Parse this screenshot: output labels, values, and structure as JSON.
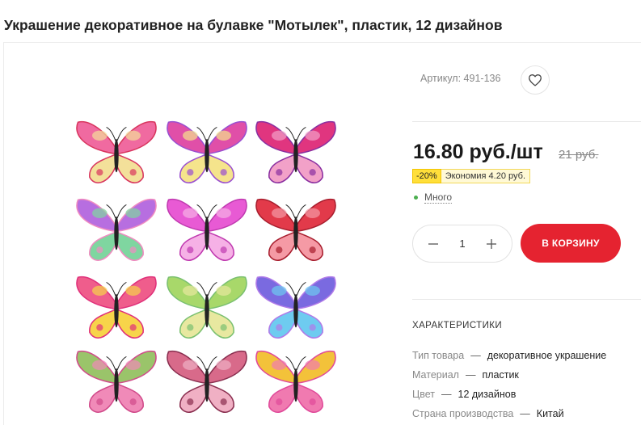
{
  "product": {
    "title": "Украшение декоративное на булавке \"Мотылек\", пластик, 12 дизайнов",
    "sku": "Артикул: 491-136",
    "price": "16.80 руб./шт",
    "old_price": "21 руб.",
    "discount_pct": "-20%",
    "savings": "Экономия 4.20 руб.",
    "stock": "Много",
    "quantity": "1",
    "cart_label": "В КОРЗИНУ"
  },
  "specs": {
    "title": "ХАРАКТЕРИСТИКИ",
    "dash": "—",
    "rows": [
      {
        "key": "Тип товара",
        "value": "декоративное украшение"
      },
      {
        "key": "Материал",
        "value": "пластик"
      },
      {
        "key": "Цвет",
        "value": "12 дизайнов"
      },
      {
        "key": "Страна производства",
        "value": "Китай"
      }
    ]
  },
  "icons": {
    "favorite": "heart-outline-icon",
    "minus": "minus-icon",
    "plus": "plus-icon",
    "stock": "green-dot-icon"
  },
  "colors": {
    "accent": "#e52330",
    "discount_bg": "#ffdf3a",
    "stock_dot": "#4caf50"
  },
  "gallery": {
    "butterflies": [
      {
        "c1": "#f06aa0",
        "c2": "#f3e09a",
        "c3": "#d8355e"
      },
      {
        "c1": "#e04fa8",
        "c2": "#f5e48c",
        "c3": "#9a4fd0"
      },
      {
        "c1": "#e0357f",
        "c2": "#f2a1c8",
        "c3": "#8a2fa0"
      },
      {
        "c1": "#b76ee0",
        "c2": "#7fd6a0",
        "c3": "#f08bc0"
      },
      {
        "c1": "#e85ad4",
        "c2": "#f6b1e6",
        "c3": "#c03ab0"
      },
      {
        "c1": "#e23a4a",
        "c2": "#f59aa5",
        "c3": "#a81e2e"
      },
      {
        "c1": "#ef5d8c",
        "c2": "#f7d44a",
        "c3": "#e0307a"
      },
      {
        "c1": "#a8d86a",
        "c2": "#e8e8a0",
        "c3": "#7ac070"
      },
      {
        "c1": "#7a6ae0",
        "c2": "#6ecbf0",
        "c3": "#b07ae8"
      },
      {
        "c1": "#9ac46a",
        "c2": "#f08ab8",
        "c3": "#d04a8a"
      },
      {
        "c1": "#d86a8a",
        "c2": "#f0b0c4",
        "c3": "#8a2f50"
      },
      {
        "c1": "#f3c23a",
        "c2": "#f07ab0",
        "c3": "#e04a9a"
      }
    ]
  }
}
